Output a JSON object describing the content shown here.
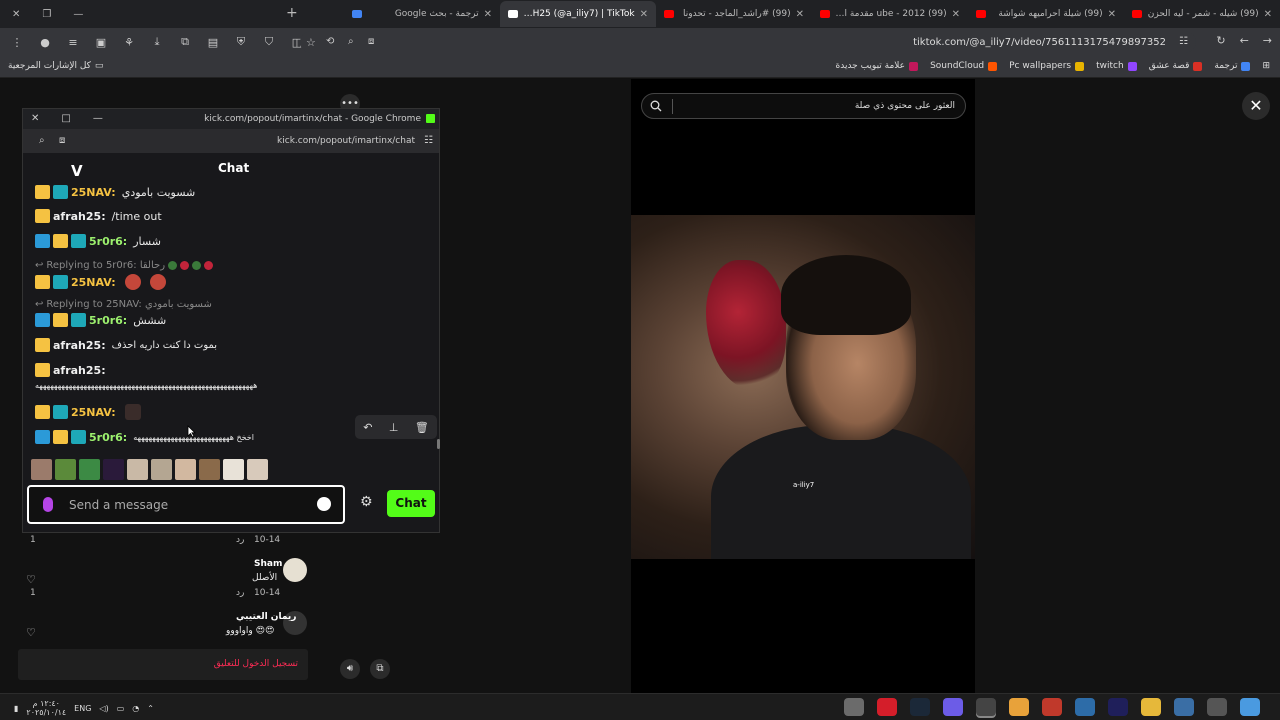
{
  "browser": {
    "tabs": [
      {
        "title": "(99) شيله - شمر - ليه الحزن",
        "color": "#ff0000",
        "active": false
      },
      {
        "title": "(99) شيلة احراميهه شواشة",
        "color": "#ff0000",
        "active": false
      },
      {
        "title": "ube - 2012 (99) مقدمة امولة",
        "color": "#ff0000",
        "active": false
      },
      {
        "title": "(99) #راشد_الماجد - تحدونا",
        "color": "#ff0000",
        "active": false
      },
      {
        "title": "AFRAH25 (@a_iliy7) | TikTok",
        "color": "#ffffff",
        "active": true
      },
      {
        "title": "ترجمة - بحث Google",
        "color": "#4285f4",
        "active": false
      }
    ],
    "url": "tiktok.com/@a_iliy7/video/7561113175479897352",
    "bookmarks_left": "كل الإشارات المرجعية",
    "bookmarks": [
      {
        "label": "ترجمة",
        "color": "#4285f4"
      },
      {
        "label": "قصة عشق",
        "color": "#d93025"
      },
      {
        "label": "twitch",
        "color": "#9146ff"
      },
      {
        "label": "Pc wallpapers",
        "color": "#e8b400"
      },
      {
        "label": "SoundCloud",
        "color": "#ff5500"
      },
      {
        "label": "علامة تبويب جديدة",
        "color": "#c2185b"
      }
    ]
  },
  "tiktok": {
    "search_placeholder": "العثور على محتوى ذي صلة",
    "video_tag": "a-iliy7",
    "comments": [
      {
        "date": "10-14",
        "reply": "رد",
        "likes": "1"
      },
      {
        "user": "Sham",
        "text": "الأصلل",
        "date": "10-14",
        "reply": "رد",
        "likes": "1"
      },
      {
        "user": "ريمان العتيبي",
        "text": "واواووو 😍😍"
      }
    ],
    "login_prompt": "تسجيل الدخول للتعليق"
  },
  "popup": {
    "title": "kick.com/popout/imartinx/chat - Google Chrome",
    "url": "kick.com/popout/imartinx/chat",
    "header": "Chat",
    "logo": "V",
    "messages": [
      {
        "user": "25NAV:",
        "color": "#f5c242",
        "text": "شسويت بامودي",
        "badges": [
          "crown",
          "sub"
        ],
        "reply": null
      },
      {
        "user": "afrah25:",
        "color": "#f0f0f0",
        "text": "/time out",
        "badges": [
          "crown"
        ],
        "reply": null
      },
      {
        "user": "5r0r6:",
        "color": "#9cf06e",
        "text": "شسار",
        "badges": [
          "mod",
          "crown",
          "sub"
        ],
        "reply": null
      },
      {
        "user": "25NAV:",
        "color": "#f5c242",
        "text": "",
        "badges": [
          "crown",
          "sub"
        ],
        "reply": "Replying to 5r0r6: رحالقا"
      },
      {
        "user": "5r0r6:",
        "color": "#9cf06e",
        "text": "ششش",
        "badges": [
          "mod",
          "crown",
          "sub"
        ],
        "reply": "Replying to 25NAV: شسويت بامودي"
      },
      {
        "user": "afrah25:",
        "color": "#f0f0f0",
        "text": "بموت دا كنت داريه احذف",
        "badges": [
          "crown"
        ],
        "reply": null
      },
      {
        "user": "afrah25:",
        "color": "#f0f0f0",
        "text": "",
        "badges": [
          "crown"
        ],
        "reply": null
      },
      {
        "user": "25NAV:",
        "color": "#f5c242",
        "text": "",
        "badges": [
          "crown",
          "sub"
        ],
        "reply": null
      },
      {
        "user": "5r0r6:",
        "color": "#9cf06e",
        "text": "اخخخ ههههههههههههههههههههههههههه",
        "badges": [
          "mod",
          "crown",
          "sub"
        ],
        "reply": null
      }
    ],
    "long_line": "هههههههههههههههههههههههههههههههههههههههههههههههههههههههههههه",
    "input_placeholder": "Send a message",
    "send_label": "Chat"
  },
  "taskbar": {
    "lang": "ENG",
    "time": "١٢:٤٠ م",
    "date": "٢٠٢٥/١٠/١٤"
  },
  "colors": {
    "kick_green": "#53fc18",
    "tiktok_red": "#fe2c55"
  }
}
